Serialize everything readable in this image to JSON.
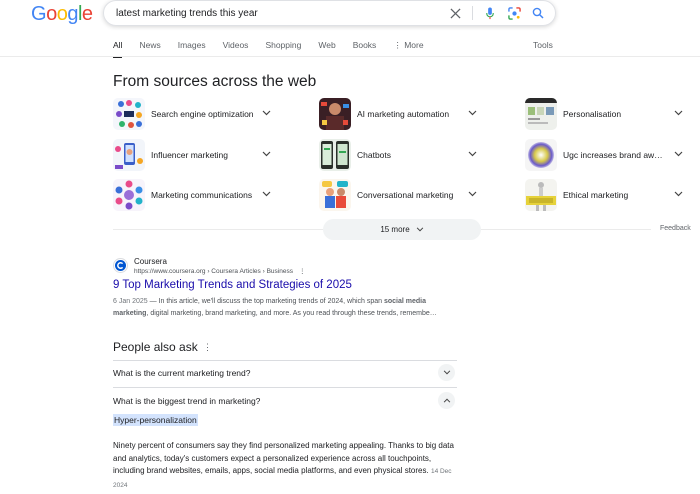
{
  "logo": {
    "text": "Google",
    "letters": [
      {
        "ch": "G",
        "color": "#4285F4"
      },
      {
        "ch": "o",
        "color": "#EA4335"
      },
      {
        "ch": "o",
        "color": "#FBBC05"
      },
      {
        "ch": "g",
        "color": "#4285F4"
      },
      {
        "ch": "l",
        "color": "#34A853"
      },
      {
        "ch": "e",
        "color": "#EA4335"
      }
    ]
  },
  "search": {
    "query": "latest marketing trends this year"
  },
  "tabs": [
    "All",
    "News",
    "Images",
    "Videos",
    "Shopping",
    "Web",
    "Books",
    "More"
  ],
  "tools_label": "Tools",
  "sources": {
    "title": "From sources across the web",
    "items": [
      "Search engine optimization",
      "AI marketing automation",
      "Personalisation",
      "Influencer marketing",
      "Chatbots",
      "Ugc increases brand aw…",
      "Marketing communications",
      "Conversational marketing",
      "Ethical marketing"
    ],
    "more_label": "15 more",
    "feedback_label": "Feedback"
  },
  "result": {
    "site_name": "Coursera",
    "url": "https://www.coursera.org › Coursera Articles › Business",
    "title": "9 Top Marketing Trends and Strategies of 2025",
    "date": "6 Jan 2025",
    "snippet_1": " — In this article, we'll discuss the top marketing trends of 2024, which span ",
    "snippet_b1": "social media marketing",
    "snippet_2": ", digital marketing, brand marketing, and more. As you read through these trends, remembe…"
  },
  "paa": {
    "title": "People also ask",
    "questions": [
      "What is the current marketing trend?",
      "What is the biggest trend in marketing?"
    ],
    "answer_highlight": "Hyper-personalization",
    "answer_text": "Ninety percent of consumers say they find personalized marketing appealing. Thanks to big data and analytics, today's customers expect a personalized experience across all touchpoints, including brand websites, emails, apps, social media platforms, and even physical stores.",
    "answer_date": "14 Dec 2024"
  }
}
